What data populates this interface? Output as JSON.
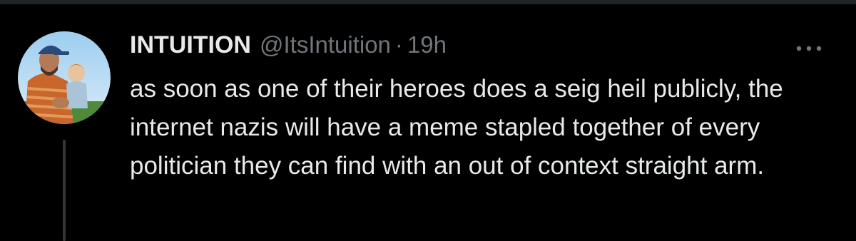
{
  "tweet": {
    "display_name": "INTUITION",
    "handle": "@ItsIntuition",
    "separator": "·",
    "time": "19h",
    "text": "as soon as one of their heroes does a seig heil publicly, the internet nazis will have a meme stapled together of every politician they can find with an out of context straight arm.",
    "avatar_icon": "profile-photo",
    "more_icon": "more-horizontal-icon"
  },
  "colors": {
    "background": "#000000",
    "text_primary": "#e7e9ea",
    "text_secondary": "#71767b",
    "thread_line": "#333639"
  }
}
